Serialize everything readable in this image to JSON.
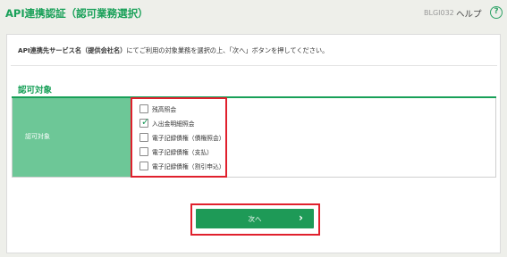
{
  "header": {
    "title": "API連携認証（認可業務選択）",
    "screen_id": "BLGI032",
    "help_label": "ヘルプ",
    "help_icon": "?"
  },
  "main": {
    "instruction_bold": "API連携先サービス名（提供会社名）",
    "instruction_rest": "にてご利用の対象業務を選択の上、「次へ」ボタンを押してください。",
    "section_title": "認可対象",
    "table_label": "認可対象",
    "options": [
      {
        "label": "残高照会",
        "checked": false
      },
      {
        "label": "入出金明細照会",
        "checked": true
      },
      {
        "label": "電子記録債権（債権照会）",
        "checked": false
      },
      {
        "label": "電子記録債権（支払）",
        "checked": false
      },
      {
        "label": "電子記録債権（割引申込）",
        "checked": false
      }
    ],
    "check_glyph": "✓",
    "next_label": "次へ",
    "next_icon": "›"
  },
  "colors": {
    "brand_green": "#18a058",
    "label_cell_green": "#6dc797",
    "button_green": "#1e9a57",
    "highlight_red": "#e0202d",
    "background": "#eeefea"
  }
}
